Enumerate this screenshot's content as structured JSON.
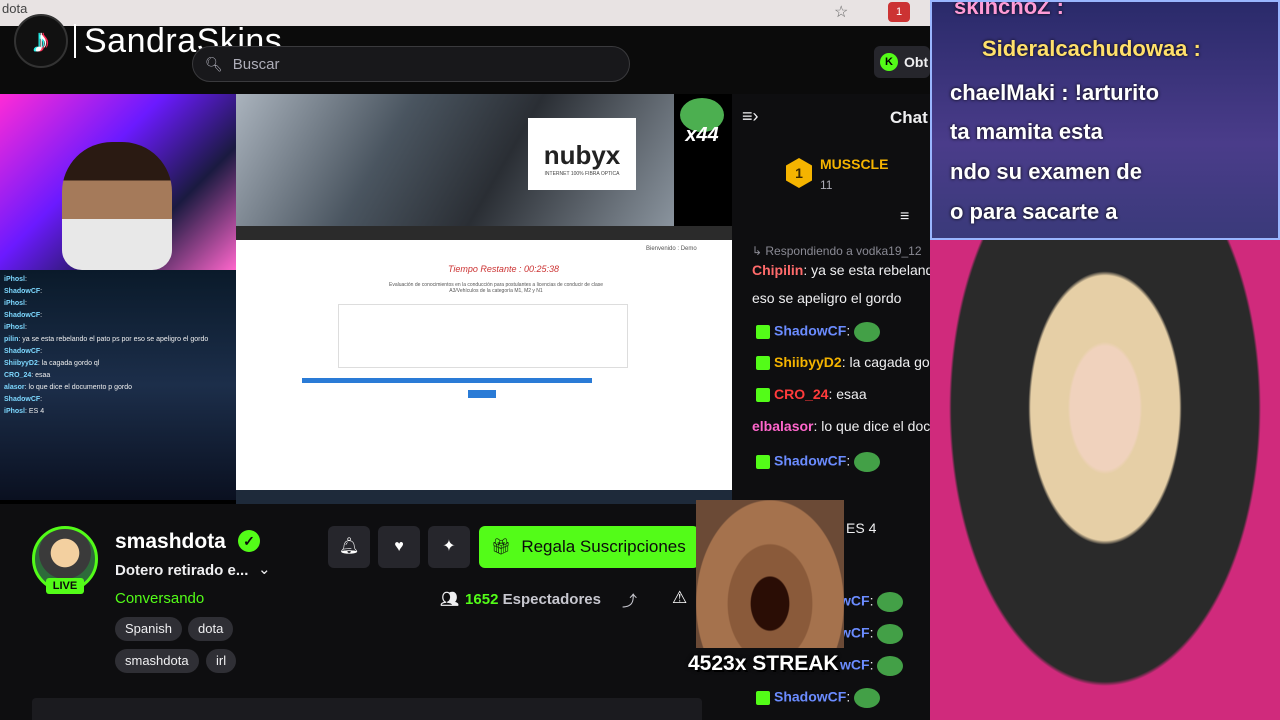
{
  "browser": {
    "tab_title": "dota",
    "star": "☆",
    "ext_badge": "1"
  },
  "site": {
    "brand": "SandraSkins",
    "search_placeholder": "Buscar",
    "obt_label": "Obt"
  },
  "video": {
    "mini_chat": [
      {
        "user": "iPhosl",
        "text": ":"
      },
      {
        "user": "ShadowCF",
        "text": ":"
      },
      {
        "user": "iPhosl",
        "text": ":"
      },
      {
        "user": "ShadowCF",
        "text": ":"
      },
      {
        "user": "iPhosl",
        "text": ":"
      },
      {
        "user": "pilin",
        "text": ": ya se esta rebelando el pato ps por eso se apeligro el gordo"
      },
      {
        "user": "ShadowCF",
        "text": ":"
      },
      {
        "user": "ShiibyyD2",
        "text": ": la cagada gordo ql"
      },
      {
        "user": "CRO_24",
        "text": ": esaa"
      },
      {
        "user": "alasor",
        "text": ": lo que dice el documento p gordo"
      },
      {
        "user": "ShadowCF",
        "text": ":"
      },
      {
        "user": "iPhosl",
        "text": ": ES 4"
      }
    ],
    "banner_brand": "nubyx",
    "banner_tagline": "INTERNET 100% FIBRA OPTICA",
    "emote_count": "x44",
    "exam": {
      "timer": "Tiempo Restante : 00:25:38",
      "subtitle": "Evaluación de conocimientos en la conducción para postulantes a licencias de conducir de clase A3/Vehículos de la categoría M1, M2 y N1",
      "welcome": "Bienvenido : Demo"
    }
  },
  "stream": {
    "channel": "smashdota",
    "live_label": "LIVE",
    "title": "Dotero retirado e...",
    "category": "Conversando",
    "tags": [
      "Spanish",
      "dota",
      "smashdota",
      "irl"
    ],
    "subscribe_label": "Regala Suscripciones",
    "viewer_count": "1652",
    "viewer_label": "Espectadores"
  },
  "overlay": {
    "streak": "4523x STREAK"
  },
  "chat": {
    "title": "Chat",
    "gift": {
      "rank": "1",
      "user": "MUSSCLE",
      "count": "11"
    },
    "reply_prefix": "Respondiendo a vodka19_12",
    "messages": [
      {
        "user": "Chipilin",
        "color": "#ff6b6b",
        "text": ": ya se esta rebelando el pato"
      },
      {
        "user": "",
        "color": "#efeff1",
        "text": "eso se apeligro el gordo"
      },
      {
        "user": "ShadowCF",
        "color": "#6b8cff",
        "text": ":"
      },
      {
        "user": "ShiibyyD2",
        "color": "#f5b400",
        "text": ": la cagada gordo"
      },
      {
        "user": "CRO_24",
        "color": "#ff3b3b",
        "text": ": esaa"
      },
      {
        "user": "elbalasor",
        "color": "#ff66cc",
        "text": ": lo que dice el documento"
      },
      {
        "user": "ShadowCF",
        "color": "#6b8cff",
        "text": ":"
      },
      {
        "user": "",
        "color": "#efeff1",
        "text": "ES 4"
      },
      {
        "user": "wCF",
        "color": "#6b8cff",
        "text": ":"
      },
      {
        "user": "wCF",
        "color": "#6b8cff",
        "text": ":"
      },
      {
        "user": "wCF",
        "color": "#6b8cff",
        "text": ":"
      },
      {
        "user": "ShadowCF",
        "color": "#6b8cff",
        "text": ":"
      }
    ]
  },
  "overlay_chat": {
    "lines": [
      "skinchoZ :",
      "Sideralcachudowaa :",
      "chaelMaki : !arturito",
      "ta mamita esta",
      "ndo su examen de",
      "o para sacarte a"
    ]
  },
  "colors": {
    "accent": "#53fc18",
    "bg": "#0e0e10",
    "gold": "#f5b400"
  }
}
